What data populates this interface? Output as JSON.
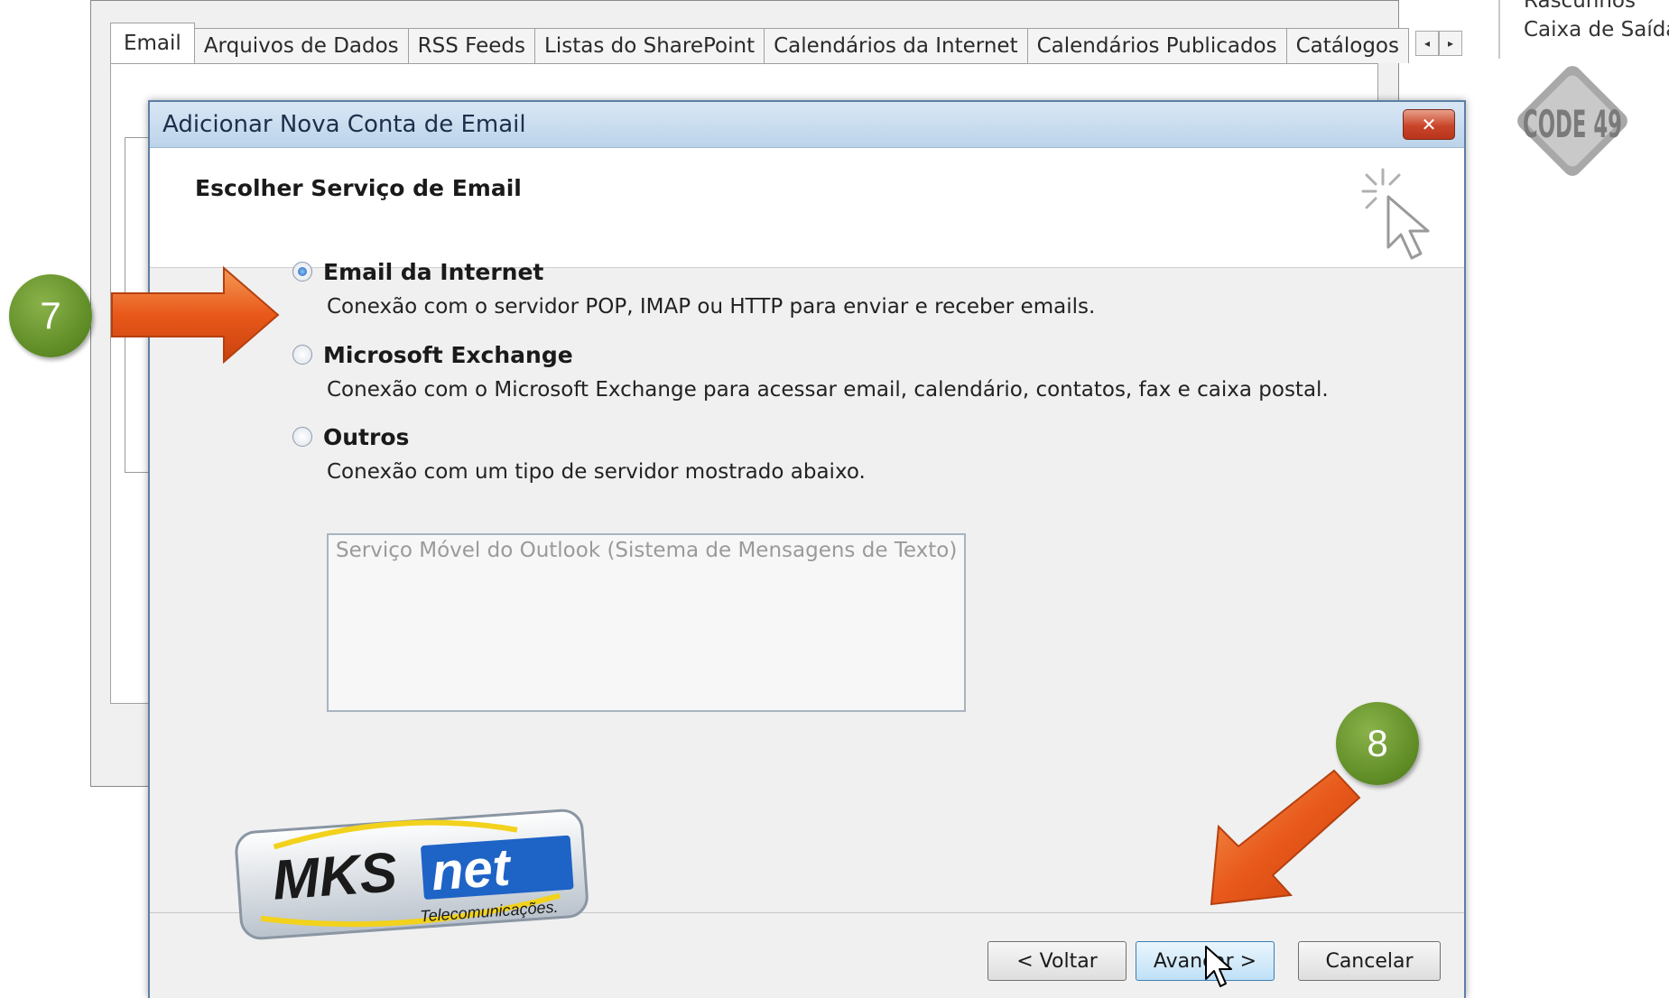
{
  "background_window": {
    "tabs": [
      {
        "label": "Email"
      },
      {
        "label": "Arquivos de Dados"
      },
      {
        "label": "RSS Feeds"
      },
      {
        "label": "Listas do SharePoint"
      },
      {
        "label": "Calendários da Internet"
      },
      {
        "label": "Calendários Publicados"
      },
      {
        "label": "Catálogos"
      }
    ],
    "tab_scroll_left": "◂",
    "tab_scroll_right": "▸"
  },
  "mail_folders": [
    {
      "label": "Rascunhos"
    },
    {
      "label": "Caixa de Saída"
    }
  ],
  "code_logo_text": "CODE 49",
  "dialog": {
    "title": "Adicionar Nova Conta de Email",
    "close_label": "✕",
    "header_title": "Escolher Serviço de Email",
    "options": [
      {
        "label": "Email da Internet",
        "description": "Conexão com o servidor POP, IMAP ou HTTP para enviar e receber emails.",
        "checked": true
      },
      {
        "label": "Microsoft Exchange",
        "description": "Conexão com o Microsoft Exchange para acessar email, calendário, contatos, fax e caixa postal.",
        "checked": false
      },
      {
        "label": "Outros",
        "description": "Conexão com um tipo de servidor mostrado abaixo.",
        "checked": false
      }
    ],
    "other_services": [
      "Serviço Móvel do Outlook (Sistema de Mensagens de Texto)"
    ],
    "buttons": {
      "back": "< Voltar",
      "next": "Avançar >",
      "cancel": "Cancelar"
    }
  },
  "annotations": {
    "step_7": "7",
    "step_8": "8",
    "arrow_color": "#e8581a",
    "badge_color": "#6a9a2e"
  },
  "brand": {
    "logo_text_1": "MKS",
    "logo_text_2": "net",
    "logo_tagline": "Telecomunicações."
  }
}
